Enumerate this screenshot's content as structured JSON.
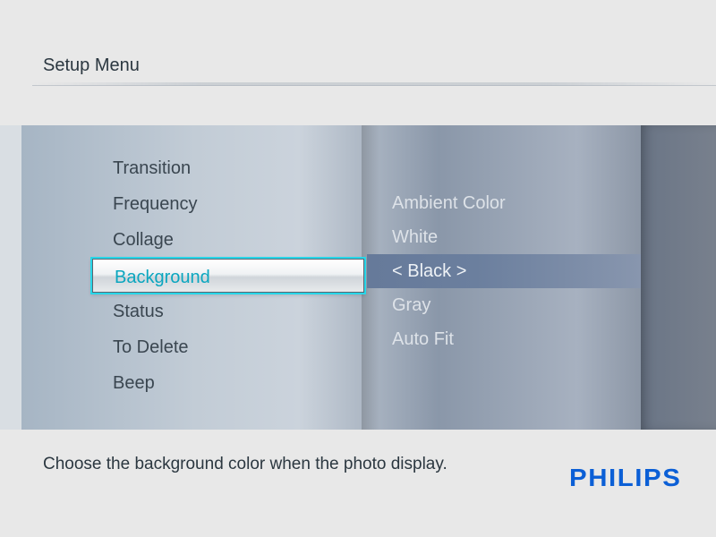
{
  "header": {
    "title": "Setup Menu"
  },
  "menu": {
    "items": [
      {
        "label": "Transition",
        "selected": false
      },
      {
        "label": "Frequency",
        "selected": false
      },
      {
        "label": "Collage",
        "selected": false
      },
      {
        "label": "Background",
        "selected": true
      },
      {
        "label": "Status",
        "selected": false
      },
      {
        "label": "To Delete",
        "selected": false
      },
      {
        "label": "Beep",
        "selected": false
      }
    ]
  },
  "options": {
    "items": [
      {
        "label": "Ambient Color",
        "current": false
      },
      {
        "label": "White",
        "current": false
      },
      {
        "label": "< Black >",
        "current": true
      },
      {
        "label": "Gray",
        "current": false
      },
      {
        "label": "Auto Fit",
        "current": false
      }
    ]
  },
  "footer": {
    "help_text": "Choose the background color when the photo display."
  },
  "brand": {
    "name": "PHILIPS"
  },
  "colors": {
    "accent": "#0aa6bf",
    "brand_blue": "#0b5fd6"
  }
}
